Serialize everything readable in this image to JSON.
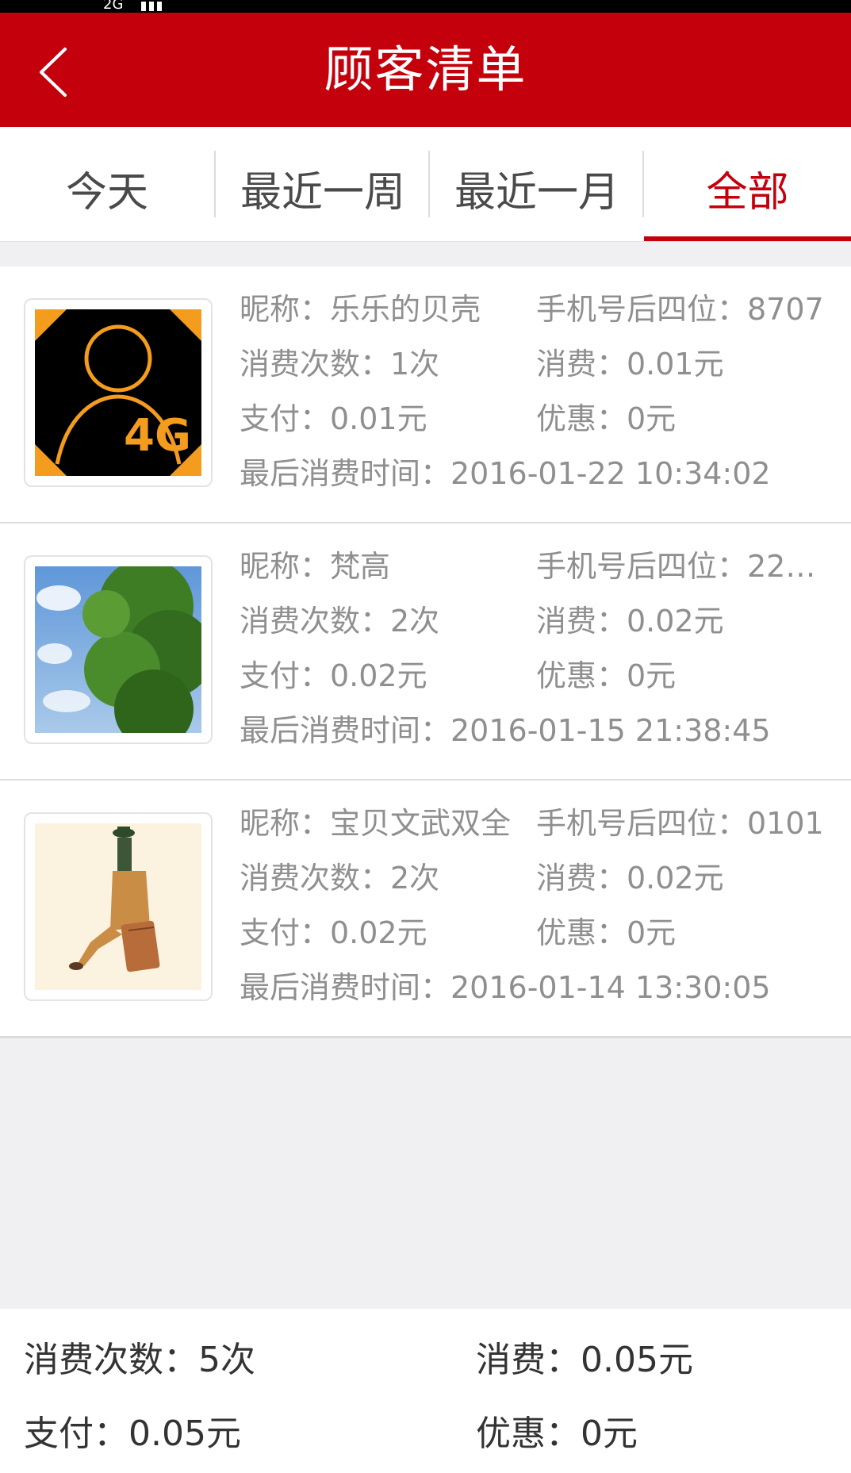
{
  "status_bar": {
    "network": "2G"
  },
  "header": {
    "title": "顾客清单",
    "back_icon": "chevron-left-icon"
  },
  "tabs": [
    {
      "label": "今天"
    },
    {
      "label": "最近一周"
    },
    {
      "label": "最近一月"
    },
    {
      "label": "全部"
    }
  ],
  "active_tab": "全部",
  "colors": {
    "brand": "#c4000c",
    "text_muted": "#8f8f8f",
    "background": "#f0f0f2"
  },
  "customers": [
    {
      "avatar": "4g-user-avatar",
      "nickname": "昵称：乐乐的贝壳",
      "phone": "手机号后四位：8707",
      "count": "消费次数：1次",
      "spend": "消费：0.01元",
      "pay": "支付：0.01元",
      "discount": "优惠：0元",
      "last_time": "最后消费时间：2016-01-22 10:34:02"
    },
    {
      "avatar": "tree-sky-avatar",
      "nickname": "昵称：梵高",
      "phone": "手机号后四位：22…",
      "count": "消费次数：2次",
      "spend": "消费：0.02元",
      "pay": "支付：0.02元",
      "discount": "优惠：0元",
      "last_time": "最后消费时间：2016-01-15 21:38:45"
    },
    {
      "avatar": "illustration-girl-suitcase-avatar",
      "nickname": "昵称：宝贝文武双全",
      "phone": "手机号后四位：0101",
      "count": "消费次数：2次",
      "spend": "消费：0.02元",
      "pay": "支付：0.02元",
      "discount": "优惠：0元",
      "last_time": "最后消费时间：2016-01-14 13:30:05"
    }
  ],
  "summary": {
    "count": "消费次数：5次",
    "spend": "消费：0.05元",
    "pay": "支付：0.05元",
    "discount": "优惠：0元"
  }
}
